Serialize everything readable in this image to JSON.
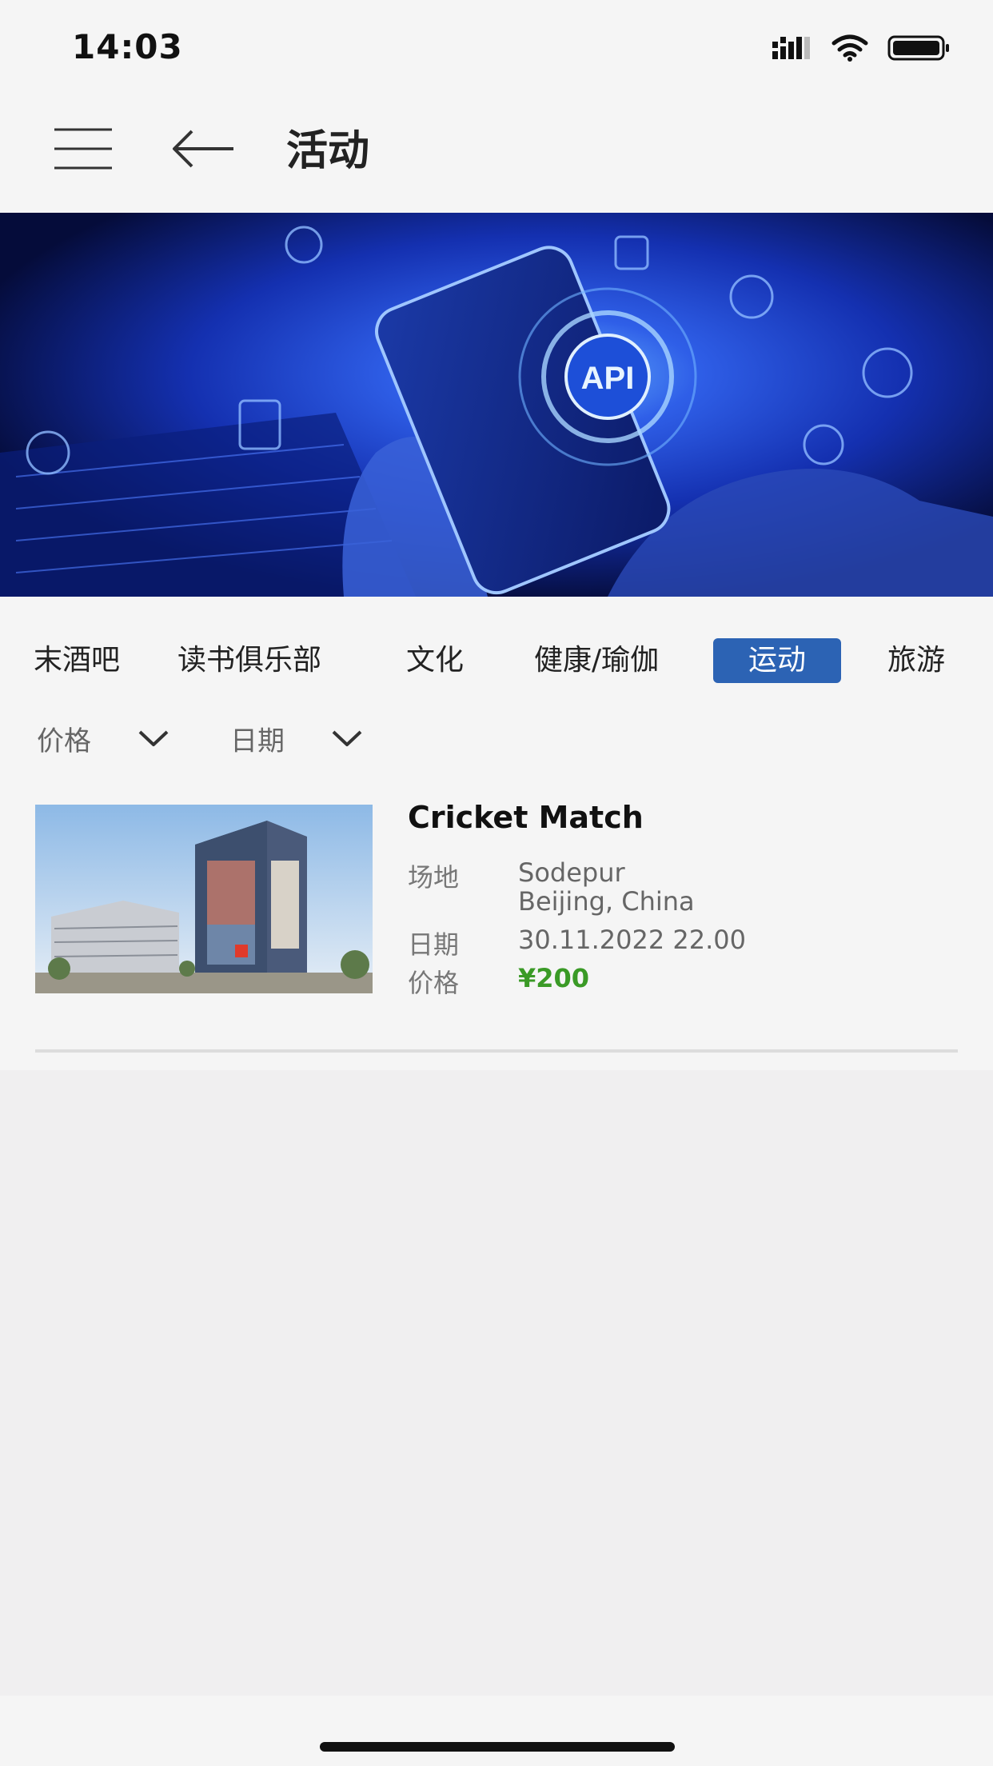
{
  "status_bar": {
    "time": "14:03"
  },
  "header": {
    "title": "活动",
    "menu_icon": "hamburger-menu-icon",
    "back_icon": "arrow-left-icon"
  },
  "banner": {
    "center_badge_text": "API"
  },
  "categories": [
    {
      "label": "末酒吧",
      "active": false
    },
    {
      "label": "读书俱乐部",
      "active": false
    },
    {
      "label": "文化",
      "active": false
    },
    {
      "label": "健康/瑜伽",
      "active": false
    },
    {
      "label": "运动",
      "active": true
    },
    {
      "label": "旅游",
      "active": false
    }
  ],
  "filters": [
    {
      "label": "价格",
      "icon": "chevron-down-icon"
    },
    {
      "label": "日期",
      "icon": "chevron-down-icon"
    }
  ],
  "events": [
    {
      "title": "Cricket Match",
      "venue_label": "场地",
      "venue_line1": "Sodepur",
      "venue_line2": "Beijing, China",
      "date_label": "日期",
      "date_value": "30.11.2022 22.00",
      "price_label": "价格",
      "price_value": "¥200"
    }
  ],
  "colors": {
    "accent": "#2c63b4",
    "price": "#3a9a26",
    "background": "#f5f5f5"
  }
}
